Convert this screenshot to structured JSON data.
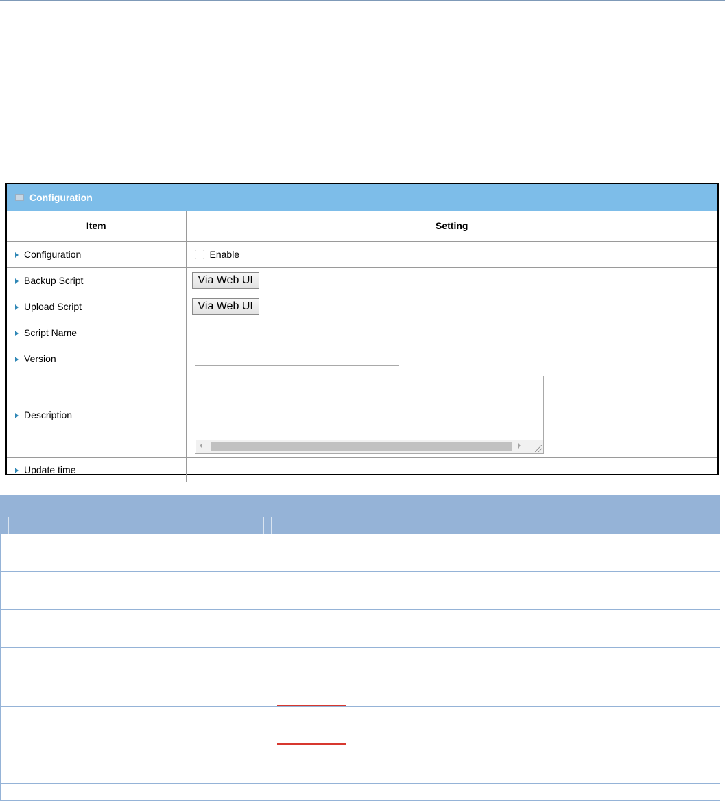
{
  "panel": {
    "title": "Configuration",
    "header_color": "#7dbde9",
    "columns": {
      "item": "Item",
      "setting": "Setting"
    },
    "rows": {
      "configuration": {
        "label": "Configuration",
        "checkbox_label": "Enable",
        "checked": false
      },
      "backup_script": {
        "label": "Backup Script",
        "button_label": "Via Web UI"
      },
      "upload_script": {
        "label": "Upload Script",
        "button_label": "Via Web UI"
      },
      "script_name": {
        "label": "Script Name",
        "value": ""
      },
      "version": {
        "label": "Version",
        "value": ""
      },
      "description": {
        "label": "Description",
        "value": ""
      },
      "update_time": {
        "label": "Update time",
        "value": ""
      }
    }
  },
  "lower_table": {
    "header_color": "#95b3d7",
    "accent_mark_color": "#d7382f",
    "row_count": 7
  }
}
